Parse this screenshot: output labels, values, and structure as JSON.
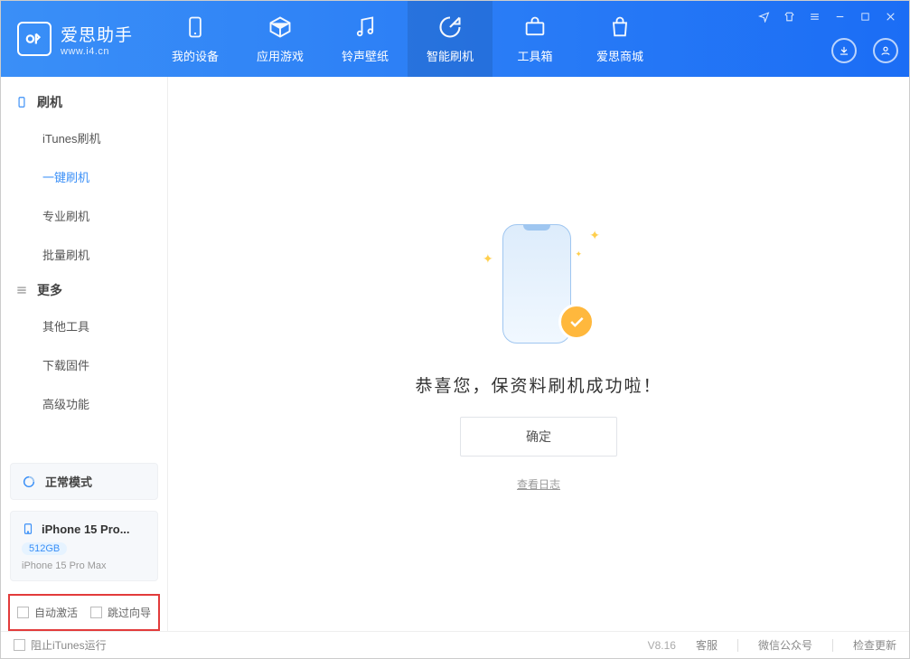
{
  "app": {
    "title": "爱思助手",
    "subtitle": "www.i4.cn"
  },
  "nav": {
    "my_device": "我的设备",
    "apps_games": "应用游戏",
    "ringtone_wallpaper": "铃声壁纸",
    "smart_flash": "智能刷机",
    "toolbox": "工具箱",
    "store": "爱思商城"
  },
  "sidebar": {
    "group_flash": "刷机",
    "itunes_flash": "iTunes刷机",
    "one_click_flash": "一键刷机",
    "pro_flash": "专业刷机",
    "batch_flash": "批量刷机",
    "group_more": "更多",
    "other_tools": "其他工具",
    "download_firmware": "下载固件",
    "advanced": "高级功能"
  },
  "mode": {
    "status": "正常模式"
  },
  "device": {
    "name": "iPhone 15 Pro...",
    "storage": "512GB",
    "model": "iPhone 15 Pro Max"
  },
  "checkboxes": {
    "auto_activate": "自动激活",
    "skip_wizard": "跳过向导",
    "block_itunes": "阻止iTunes运行"
  },
  "main": {
    "success": "恭喜您，保资料刷机成功啦！",
    "ok": "确定",
    "view_log": "查看日志"
  },
  "footer": {
    "version": "V8.16",
    "support": "客服",
    "wechat": "微信公众号",
    "check_update": "检查更新"
  }
}
